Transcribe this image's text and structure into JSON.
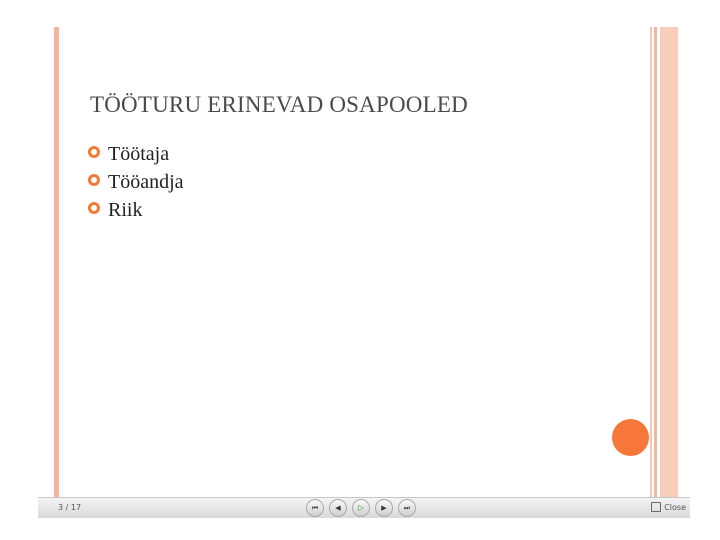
{
  "slide": {
    "title": "TÖÖTURU ERINEVAD OSAPOOLED",
    "bullets": [
      "Töötaja",
      "Tööandja",
      "Riik"
    ]
  },
  "navbar": {
    "slide_counter": "3 / 17",
    "controls": [
      "first-slide-icon",
      "previous-slide-icon",
      "play-icon",
      "next-slide-icon",
      "last-slide-icon"
    ],
    "close_label": "Close"
  },
  "colors": {
    "accent": "#f7773a",
    "stripe": "#f5b59b",
    "title": "#4a4a4a"
  }
}
